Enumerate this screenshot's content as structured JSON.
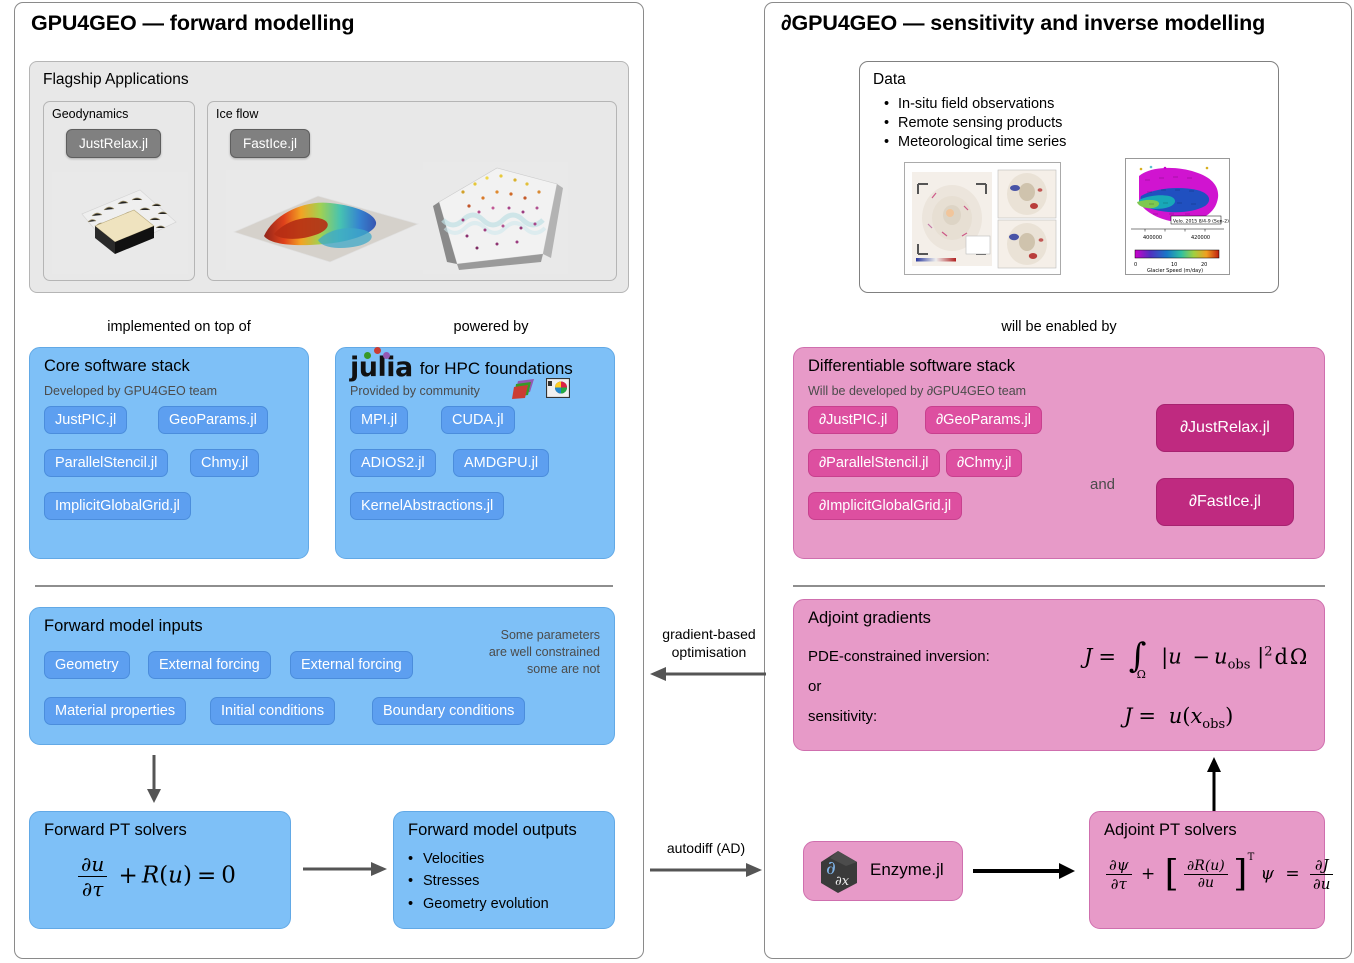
{
  "left_panel": {
    "title": "GPU4GEO — forward modelling",
    "flagship": {
      "heading": "Flagship Applications",
      "cards": [
        {
          "title": "Geodynamics",
          "app": "JustRelax.jl"
        },
        {
          "title": "Ice flow",
          "app": "FastIce.jl"
        }
      ]
    },
    "connectors": {
      "left": "implemented on top of",
      "right": "powered by"
    },
    "core_stack": {
      "title": "Core software stack",
      "subtitle": "Developed by GPU4GEO team",
      "packages": [
        "JustPIC.jl",
        "GeoParams.jl",
        "ParallelStencil.jl",
        "Chmy.jl",
        "ImplicitGlobalGrid.jl"
      ]
    },
    "julia_stack": {
      "logo_word": "julia",
      "title": "for HPC foundations",
      "subtitle": "Provided by community",
      "packages": [
        "MPI.jl",
        "CUDA.jl",
        "ADIOS2.jl",
        "AMDGPU.jl",
        "KernelAbstractions.jl"
      ]
    },
    "inputs": {
      "title": "Forward model inputs",
      "note": [
        "Some parameters",
        "are well constrained",
        "some are not"
      ],
      "items": [
        "Geometry",
        "External forcing",
        "External forcing",
        "Material properties",
        "Initial conditions",
        "Boundary conditions"
      ]
    },
    "solvers": {
      "title": "Forward PT solvers",
      "equation": "∂u/∂τ + R(u) = 0"
    },
    "outputs": {
      "title": "Forward model outputs",
      "items": [
        "Velocities",
        "Stresses",
        "Geometry evolution"
      ]
    }
  },
  "right_panel": {
    "title": "∂GPU4GEO — sensitivity and inverse modelling",
    "data": {
      "heading": "Data",
      "items": [
        "In-situ field observations",
        "Remote sensing products",
        "Meteorological time series"
      ],
      "thumb_caption": "Velo. 2015 8/4-9 (Sen-2)",
      "colorbar_label": "Glacier Speed (m/day)",
      "colorbar_ticks": [
        "0",
        "10",
        "20"
      ],
      "x_ticks": [
        "400000",
        "420000"
      ]
    },
    "connector": "will be enabled by",
    "diff_stack": {
      "title": "Differentiable software stack",
      "subtitle": "Will be developed by ∂GPU4GEO team",
      "packages": [
        "∂JustPIC.jl",
        "∂GeoParams.jl",
        "∂ParallelStencil.jl",
        "∂Chmy.jl",
        "∂ImplicitGlobalGrid.jl"
      ],
      "conjunction": "and",
      "apps": [
        "∂JustRelax.jl",
        "∂FastIce.jl"
      ]
    },
    "adjoint": {
      "title": "Adjoint gradients",
      "label_inversion": "PDE-constrained inversion:",
      "label_or": "or",
      "label_sensitivity": "sensitivity:",
      "eq_inversion": "J = ∫_Ω |u − u_obs|² dΩ",
      "eq_sensitivity": "J = u(x_obs)"
    },
    "enzyme": {
      "label": "Enzyme.jl"
    },
    "adjoint_solvers": {
      "title": "Adjoint PT solvers",
      "equation": "∂ψ/∂τ + [∂R(u)/∂u]ᵀ ψ = ∂J/∂u"
    }
  },
  "middle": {
    "gradient_label_line1": "gradient-based",
    "gradient_label_line2": "optimisation",
    "autodiff_label": "autodiff  (AD)"
  },
  "colors": {
    "blue_container": "#7ec0f7",
    "blue_pill": "#5d9ff0",
    "pink_container": "#e79ac8",
    "pink_pill": "#dd4fa0",
    "pink_dark": "#bf2a80",
    "grey_card": "#e8e8e8",
    "grey_pill": "#808080"
  }
}
